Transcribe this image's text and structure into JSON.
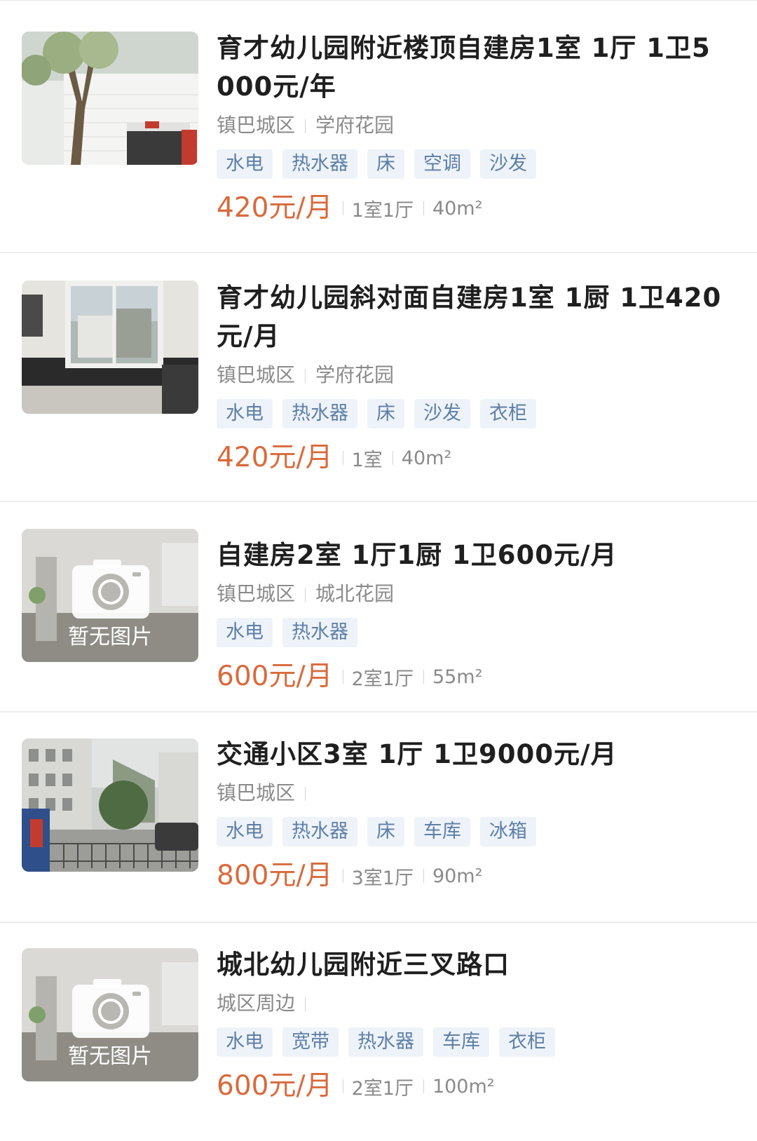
{
  "listings": [
    {
      "title": "育才幼儿园附近楼顶自建房1室 1厅 1卫5000元/年",
      "district": "镇巴城区",
      "community": "学府花园",
      "tags": [
        "水电",
        "热水器",
        "床",
        "空调",
        "沙发"
      ],
      "price": "420元/月",
      "rooms": "1室1厅",
      "area": "40m²",
      "thumbnail": "photo-building-tree"
    },
    {
      "title": "育才幼儿园斜对面自建房1室 1厨 1卫420元/月",
      "district": "镇巴城区",
      "community": "学府花园",
      "tags": [
        "水电",
        "热水器",
        "床",
        "沙发",
        "衣柜"
      ],
      "price": "420元/月",
      "rooms": "1室",
      "area": "40m²",
      "thumbnail": "photo-kitchen-window"
    },
    {
      "title": "自建房2室 1厅1厨 1卫600元/月",
      "district": "镇巴城区",
      "community": "城北花园",
      "tags": [
        "水电",
        "热水器"
      ],
      "price": "600元/月",
      "rooms": "2室1厅",
      "area": "55m²",
      "thumbnail": "camera-icon",
      "placeholder_text": "暂无图片"
    },
    {
      "title": "交通小区3室 1厅 1卫9000元/月",
      "district": "镇巴城区",
      "community": "",
      "tags": [
        "水电",
        "热水器",
        "床",
        "车库",
        "冰箱"
      ],
      "price": "800元/月",
      "rooms": "3室1厅",
      "area": "90m²",
      "thumbnail": "photo-residential-gate"
    },
    {
      "title": "城北幼儿园附近三叉路口",
      "district": "城区周边",
      "community": "",
      "tags": [
        "水电",
        "宽带",
        "热水器",
        "车库",
        "衣柜"
      ],
      "price": "600元/月",
      "rooms": "2室1厅",
      "area": "100m²",
      "thumbnail": "camera-icon",
      "placeholder_text": "暂无图片"
    }
  ],
  "colors": {
    "price": "#d96a3c",
    "tag_bg": "#eef3f9",
    "tag_text": "#5d7fa6",
    "muted_text": "#8a8a8a"
  }
}
